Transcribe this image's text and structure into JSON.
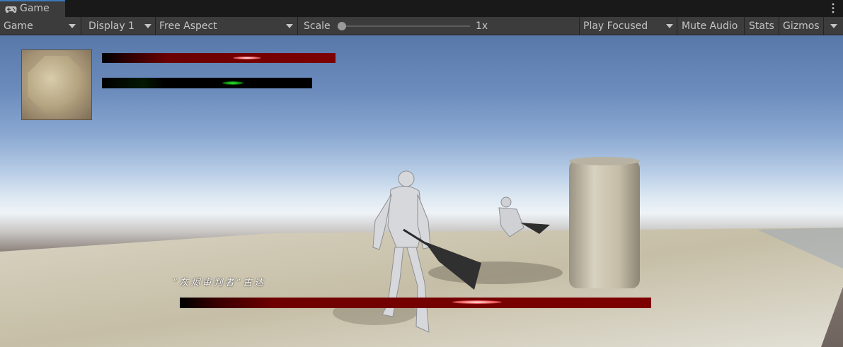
{
  "tab": {
    "title": "Game"
  },
  "toolbar": {
    "view_mode": "Game",
    "display": "Display 1",
    "aspect": "Free Aspect",
    "scale_label": "Scale",
    "scale_value": "1x",
    "scale_slider_fraction": 0.0,
    "play_mode": "Play Focused",
    "mute_audio": "Mute Audio",
    "stats": "Stats",
    "gizmos": "Gizmos"
  },
  "hud": {
    "boss_name": "“灰烬审判者”古达"
  },
  "colors": {
    "health": "#7d0000",
    "mana": "#12a012",
    "accent_tab": "#3a79bb"
  },
  "icons": [
    "gamepad-icon",
    "kebab-menu-icon",
    "dropdown-caret-icon"
  ]
}
